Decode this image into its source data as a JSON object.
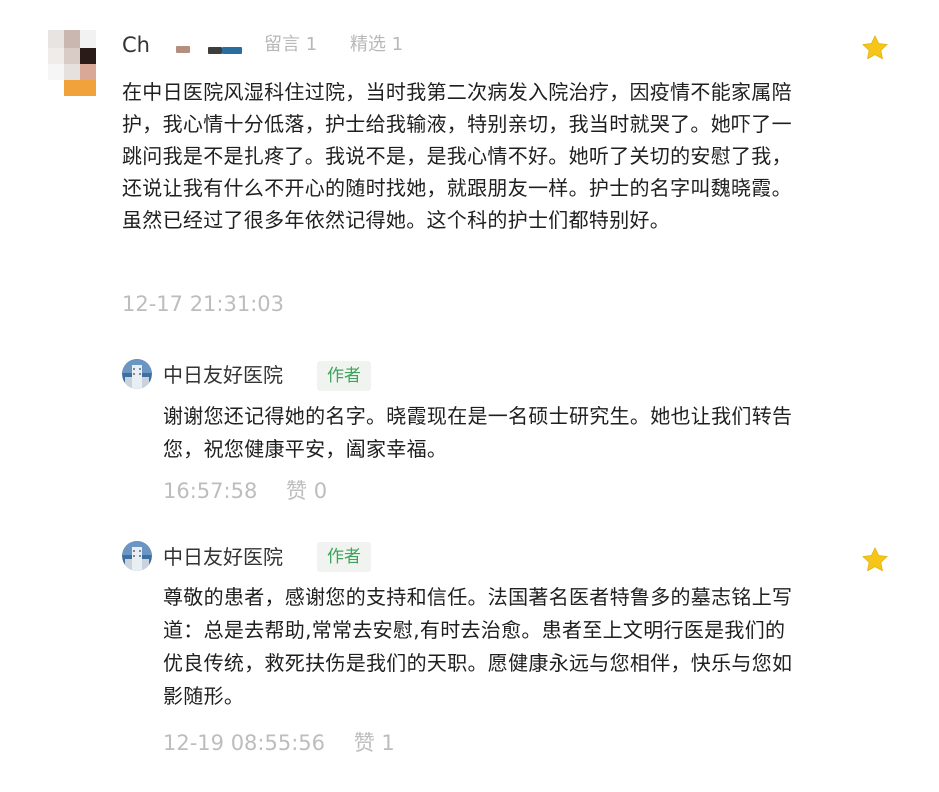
{
  "comment": {
    "nickname": "Ch",
    "reply_count_label": "留言 1",
    "featured_count_label": "精选 1",
    "content": "在中日医院风湿科住过院，当时我第二次病发入院治疗，因疫情不能家属陪护，我心情十分低落，护士给我输液，特别亲切，我当时就哭了。她吓了一跳问我是不是扎疼了。我说不是，是我心情不好。她听了关切的安慰了我，还说让我有什么不开心的随时找她，就跟朋友一样。护士的名字叫魏晓霞。虽然已经过了很多年依然记得她。这个科的护士们都特别好。",
    "timestamp": "12-17 21:31:03"
  },
  "replies": [
    {
      "name": "中日友好医院",
      "badge": "作者",
      "content": "谢谢您还记得她的名字。晓霞现在是一名硕士研究生。她也让我们转告您，祝您健康平安，阖家幸福。",
      "time": "16:57:58",
      "likes": "赞 0"
    },
    {
      "name": "中日友好医院",
      "badge": "作者",
      "content": "尊敬的患者，感谢您的支持和信任。法国著名医者特鲁多的墓志铭上写道：总是去帮助,常常去安慰,有时去治愈。患者至上文明行医是我们的优良传统，救死扶伤是我们的天职。愿健康永远与您相伴，快乐与您如影随形。",
      "time": "12-19 08:55:56",
      "likes": "赞 1"
    }
  ],
  "icons": {
    "featured_star": "star-icon",
    "avatar": "hospital-building-avatar"
  },
  "colors": {
    "star": "#f5c518",
    "author_badge_text": "#3ea35b",
    "muted_text": "#bdbdbd"
  }
}
